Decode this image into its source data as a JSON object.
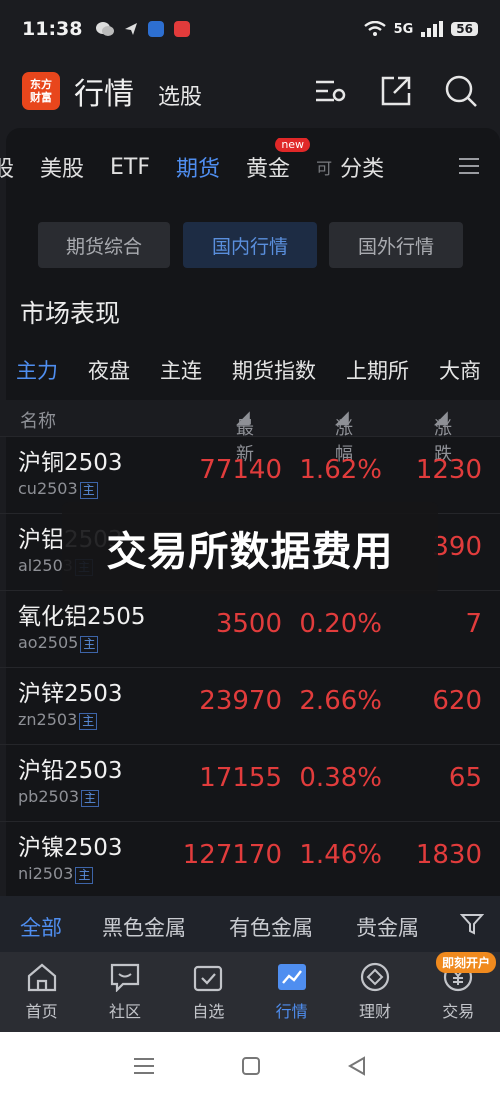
{
  "status": {
    "time": "11:38",
    "network": "5G",
    "battery": "56"
  },
  "header": {
    "logo_line1": "东方",
    "logo_line2": "财富",
    "title": "行情",
    "subtitle": "选股"
  },
  "category_tabs": [
    {
      "label": "股"
    },
    {
      "label": "美股"
    },
    {
      "label": "ETF"
    },
    {
      "label": "期货"
    },
    {
      "label": "黄金",
      "badge": "new"
    },
    {
      "label": "可"
    },
    {
      "label": "分类"
    }
  ],
  "segments": [
    "期货综合",
    "国内行情",
    "国外行情"
  ],
  "section_title": "市场表现",
  "market_tabs": [
    "主力",
    "夜盘",
    "主连",
    "期货指数",
    "上期所",
    "大商"
  ],
  "table_header": {
    "name": "名称",
    "latest": "最新",
    "change_pct": "涨幅",
    "change": "涨跌"
  },
  "rows": [
    {
      "name": "沪铜2503",
      "code": "cu2503",
      "tag": "主",
      "latest": "77140",
      "change_pct": "1.62%",
      "change": "1230"
    },
    {
      "name": "沪铝2503",
      "code": "al2503",
      "tag": "主",
      "latest": "",
      "change_pct": "",
      "change": "390"
    },
    {
      "name": "氧化铝2505",
      "code": "ao2505",
      "tag": "主",
      "latest": "3500",
      "change_pct": "0.20%",
      "change": "7"
    },
    {
      "name": "沪锌2503",
      "code": "zn2503",
      "tag": "主",
      "latest": "23970",
      "change_pct": "2.66%",
      "change": "620"
    },
    {
      "name": "沪铅2503",
      "code": "pb2503",
      "tag": "主",
      "latest": "17155",
      "change_pct": "0.38%",
      "change": "65"
    },
    {
      "name": "沪镍2503",
      "code": "ni2503",
      "tag": "主",
      "latest": "127170",
      "change_pct": "1.46%",
      "change": "1830"
    }
  ],
  "toast": "交易所数据费用",
  "filter_tabs": [
    "全部",
    "黑色金属",
    "有色金属",
    "贵金属"
  ],
  "bottom_nav": [
    {
      "label": "首页"
    },
    {
      "label": "社区"
    },
    {
      "label": "自选"
    },
    {
      "label": "行情"
    },
    {
      "label": "理财"
    },
    {
      "label": "交易",
      "badge": "即刻开户"
    }
  ],
  "colors": {
    "accent": "#4f8ef0",
    "up": "#e13c3c",
    "background": "#141518"
  }
}
